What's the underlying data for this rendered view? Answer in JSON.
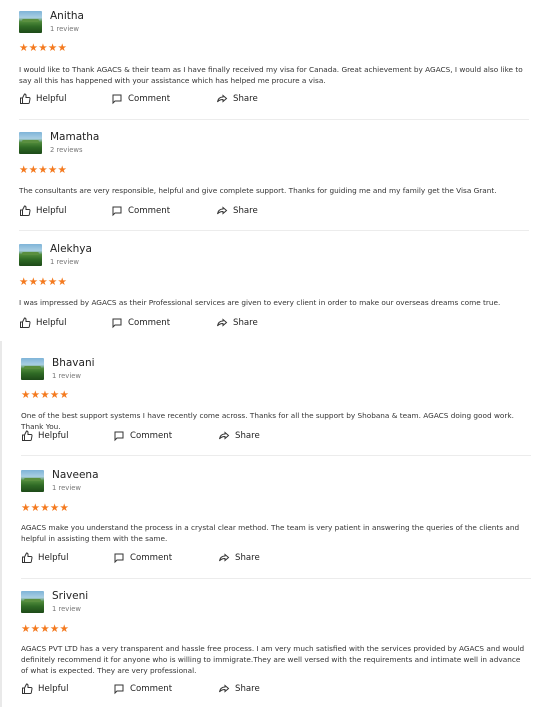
{
  "reviews": [
    {
      "name": "Anitha",
      "count": "1 review",
      "stars": "★★★★★",
      "text": "I would like to Thank AGACS & their team as I have finally received my visa for Canada. Great achievement by AGACS, I would also like to say all this has happened with your assistance which has helped me procure a visa."
    },
    {
      "name": "Mamatha",
      "count": "2 reviews",
      "stars": "★★★★★",
      "text": "The consultants are very responsible, helpful and give complete support. Thanks for guiding me and my family get the Visa Grant."
    },
    {
      "name": "Alekhya",
      "count": "1 review",
      "stars": "★★★★★",
      "text": "I was impressed by AGACS as their Professional services are given to every client in order to make our overseas dreams come true."
    },
    {
      "name": "Bhavani",
      "count": "1 review",
      "stars": "★★★★★",
      "text": "One of the best support systems I have recently come across. Thanks for all the support by Shobana & team. AGACS doing good work. Thank You."
    },
    {
      "name": "Naveena",
      "count": "1 review",
      "stars": "★★★★★",
      "text": "AGACS make you understand the process in a crystal clear method. The team is very patient in answering the queries of the clients and helpful in assisting them with the same."
    },
    {
      "name": "Sriveni",
      "count": "1 review",
      "stars": "★★★★★",
      "text": "AGACS PVT LTD has a very transparent and hassle free process. I am very much satisfied with the services provided by AGACS and would definitely recommend it for anyone who is willing to immigrate.They are well versed with the requirements and intimate well in advance of what is expected. They are very professional."
    }
  ],
  "actions": {
    "helpful": "Helpful",
    "comment": "Comment",
    "share": "Share"
  },
  "icons": {
    "helpful": "thumbs-up-icon",
    "comment": "comment-icon",
    "share": "share-icon"
  },
  "colors": {
    "star": "#f47a1f"
  }
}
